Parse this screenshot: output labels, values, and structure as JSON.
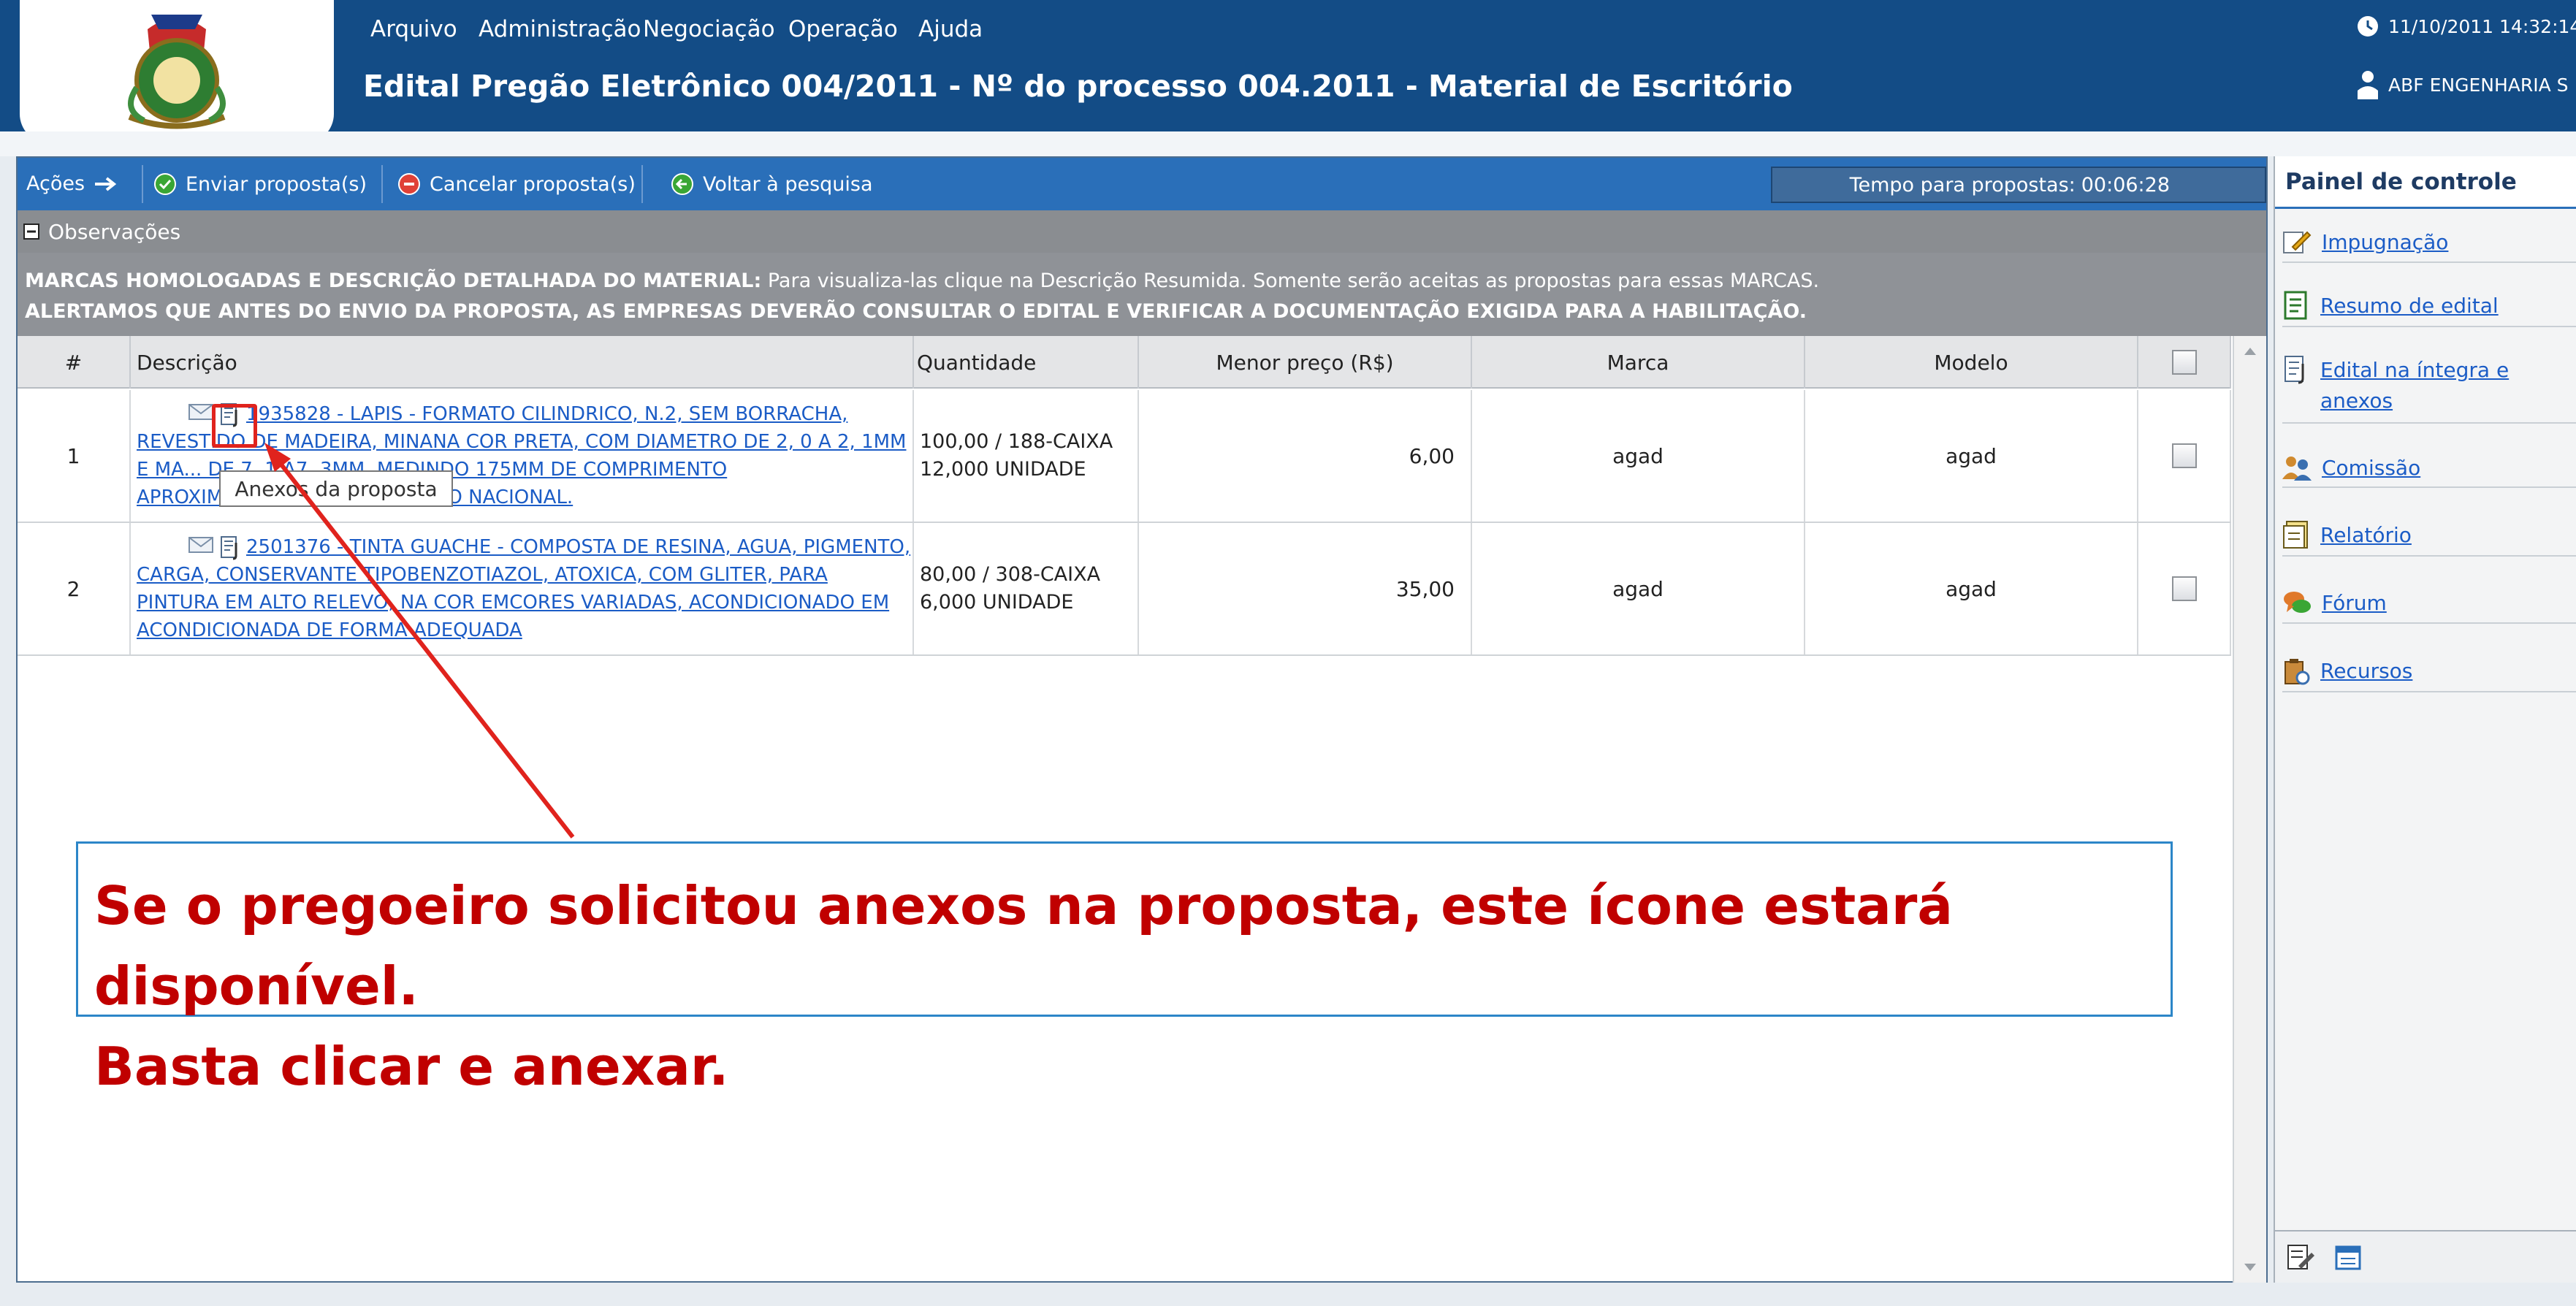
{
  "menu": {
    "items": [
      "Arquivo",
      "Administração",
      "Negociação",
      "Operação",
      "Ajuda"
    ]
  },
  "header": {
    "title": "Edital Pregão Eletrônico 004/2011 - Nº do processo 004.2011 - Material de Escritório",
    "datetime": "11/10/2011 14:32:14",
    "company": "ABF ENGENHARIA S"
  },
  "toolbar": {
    "actions_label": "Ações",
    "send": "Enviar proposta(s)",
    "cancel": "Cancelar proposta(s)",
    "back": "Voltar à pesquisa",
    "timer_label": "Tempo para propostas:",
    "timer_value": "00:06:28"
  },
  "observations": {
    "toggle_label": "Observações",
    "line1_bold": "MARCAS HOMOLOGADAS E DESCRIÇÃO DETALHADA DO MATERIAL:",
    "line1_rest": " Para visualiza-las clique na Descrição Resumida. Somente serão aceitas as propostas para essas MARCAS.",
    "line2_bold": "ALERTAMOS QUE ANTES DO ENVIO DA PROPOSTA, AS EMPRESAS DEVERÃO CONSULTAR O EDITAL E VERIFICAR A DOCUMENTAÇÃO EXIGIDA PARA A HABILITAÇÃO."
  },
  "grid": {
    "columns": [
      "#",
      "Descrição",
      "Quantidade",
      "Menor preço (R$)",
      "Marca",
      "Modelo"
    ],
    "rows": [
      {
        "num": "1",
        "desc": "1935828 - LAPIS - FORMATO CILINDRICO, N.2, SEM BORRACHA, REVESTIDO DE MADEIRA, MINANA COR PRETA, COM DIAMETRO DE 2, 0 A 2, 1MM E MA... DE 7, 1 A7, 3MM, MEDINDO 175MM DE COMPRIMENTO APROXIMADAMENTE, FABRICACAO NACIONAL.",
        "qty1": "100,00 / 188-CAIXA",
        "qty2": "12,000 UNIDADE",
        "price": "6,00",
        "brand": "agad",
        "model": "agad"
      },
      {
        "num": "2",
        "desc": "2501376 - TINTA GUACHE - COMPOSTA DE RESINA, AGUA, PIGMENTO, CARGA, CONSERVANTE TIPOBENZOTIAZOL, ATOXICA, COM GLITER, PARA PINTURA EM ALTO RELEVO, NA COR EMCORES VARIADAS, ACONDICIONADO EM ACONDICIONADA DE FORMA ADEQUADA",
        "qty1": "80,00 / 308-CAIXA",
        "qty2": "6,000 UNIDADE",
        "price": "35,00",
        "brand": "agad",
        "model": "agad"
      }
    ]
  },
  "tooltip": "Anexos da proposta",
  "callout": {
    "line1": "Se o pregoeiro solicitou anexos na proposta, este ícone estará disponível.",
    "line2": "Basta clicar e anexar."
  },
  "panel": {
    "title": "Painel de controle",
    "items": [
      "Impugnação",
      "Resumo de edital",
      "Edital na íntegra e anexos",
      "Comissão",
      "Relatório",
      "Fórum",
      "Recursos"
    ]
  },
  "colors": {
    "header_bg": "#134c86",
    "toolbar_bg": "#2a6fb9",
    "callout_text": "#c00000",
    "arrow": "#e0231d"
  }
}
